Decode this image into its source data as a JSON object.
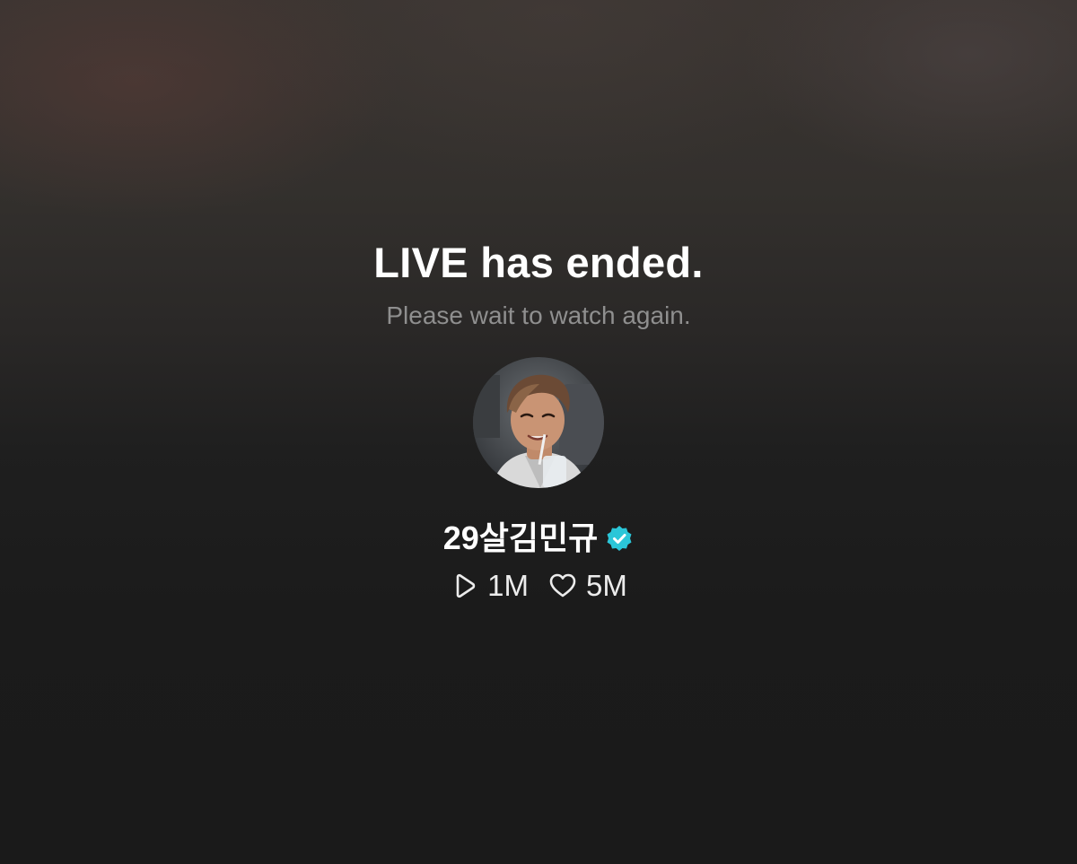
{
  "status": {
    "title": "LIVE has ended.",
    "subtitle": "Please wait to watch again."
  },
  "profile": {
    "avatar": "profile-photo",
    "name": "29살김민규",
    "verified_icon": "verified-badge-icon",
    "verified_color": "#2bc6d8"
  },
  "stats": {
    "plays": {
      "icon": "play-icon",
      "value": "1M"
    },
    "likes": {
      "icon": "heart-icon",
      "value": "5M"
    }
  }
}
